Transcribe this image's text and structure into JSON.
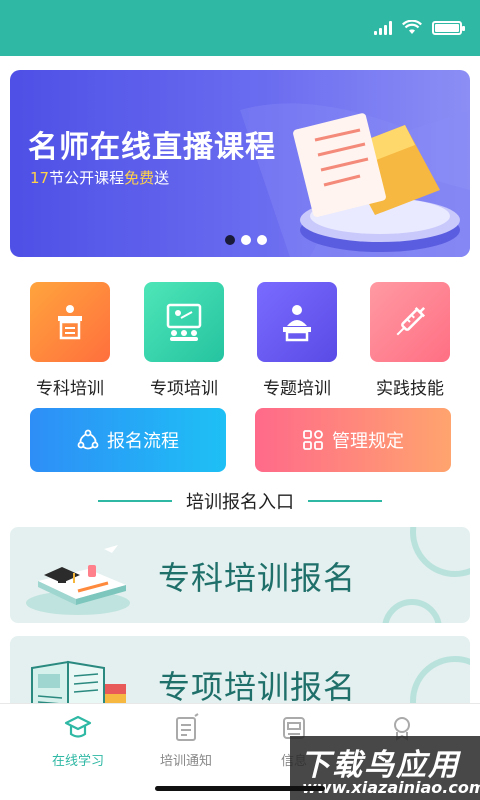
{
  "banner": {
    "title": "名师在线直播课程",
    "sub_count": "17",
    "sub_middle": "节公开课程",
    "sub_free": "免费",
    "sub_end": "送",
    "slide_count": 3,
    "active_slide": 1
  },
  "categories": [
    {
      "label": "专科培训",
      "icon": "podium-icon",
      "color": "#ff8a3d"
    },
    {
      "label": "专项培训",
      "icon": "classroom-icon",
      "color": "#33d1a8"
    },
    {
      "label": "专题培训",
      "icon": "lecturer-icon",
      "color": "#6a5cf0"
    },
    {
      "label": "实践技能",
      "icon": "syringe-icon",
      "color": "#ff7b8a"
    }
  ],
  "actions": [
    {
      "label": "报名流程",
      "icon": "process-icon"
    },
    {
      "label": "管理规定",
      "icon": "grid-icon"
    }
  ],
  "section": {
    "title": "培训报名入口"
  },
  "cards": [
    {
      "label": "专科培训报名",
      "icon": "graduation-books-icon"
    },
    {
      "label": "专项培训报名",
      "icon": "open-book-icon"
    }
  ],
  "nav": [
    {
      "label": "在线学习",
      "icon": "graduation-cap-icon",
      "active": true
    },
    {
      "label": "培训通知",
      "icon": "notice-icon",
      "active": false
    },
    {
      "label": "信息",
      "icon": "info-icon",
      "active": false
    },
    {
      "label": "",
      "icon": "profile-icon",
      "active": false
    }
  ],
  "watermark": {
    "big": "下载鸟应用",
    "small": "www.xiazainiao.com"
  },
  "colors": {
    "primary": "#2fb8a4",
    "banner": "#5a5cec",
    "card_text": "#1f6f6a"
  }
}
